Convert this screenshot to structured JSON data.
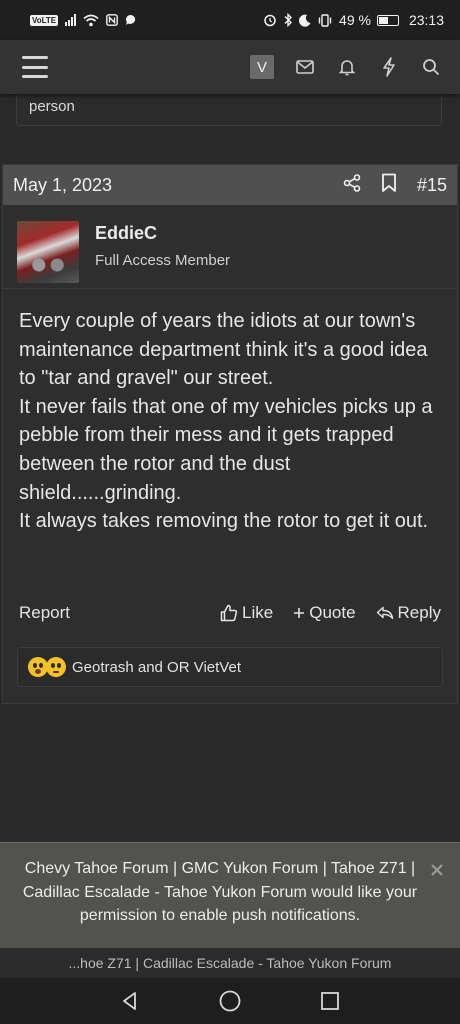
{
  "status_bar": {
    "volte": "VoLTE",
    "battery": "49 %",
    "time": "23:13"
  },
  "header": {
    "user_initial": "V",
    "icons": [
      "menu-icon",
      "mail-icon",
      "bell-icon",
      "lightning-icon",
      "search-icon"
    ]
  },
  "previous_post": {
    "trailing_text": "person"
  },
  "post": {
    "date": "May 1, 2023",
    "number": "#15",
    "author": {
      "name": "EddieC",
      "title": "Full Access Member"
    },
    "body": [
      "Every couple of years the idiots at our town's maintenance department think it's a good idea to \"tar and gravel\" our street.",
      "It never fails that one of my vehicles picks up a pebble from their mess and it gets trapped between the rotor and the dust shield......grinding.",
      "It always takes removing the rotor to get it out."
    ],
    "actions": {
      "report": "Report",
      "like": "Like",
      "quote": "Quote",
      "reply": "Reply"
    },
    "reactions": {
      "names": "Geotrash and OR VietVet"
    }
  },
  "notification": {
    "message": "Chevy Tahoe Forum | GMC Yukon Forum | Tahoe Z71 | Cadillac Escalade - Tahoe Yukon Forum would like your permission to enable push notifications."
  },
  "url_bar": {
    "text": "...hoe Z71 | Cadillac Escalade - Tahoe Yukon Forum"
  },
  "colors": {
    "background": "#2a2a2a",
    "header_bar": "#333333",
    "post_header": "#505050",
    "notification_bg": "#52534e"
  }
}
